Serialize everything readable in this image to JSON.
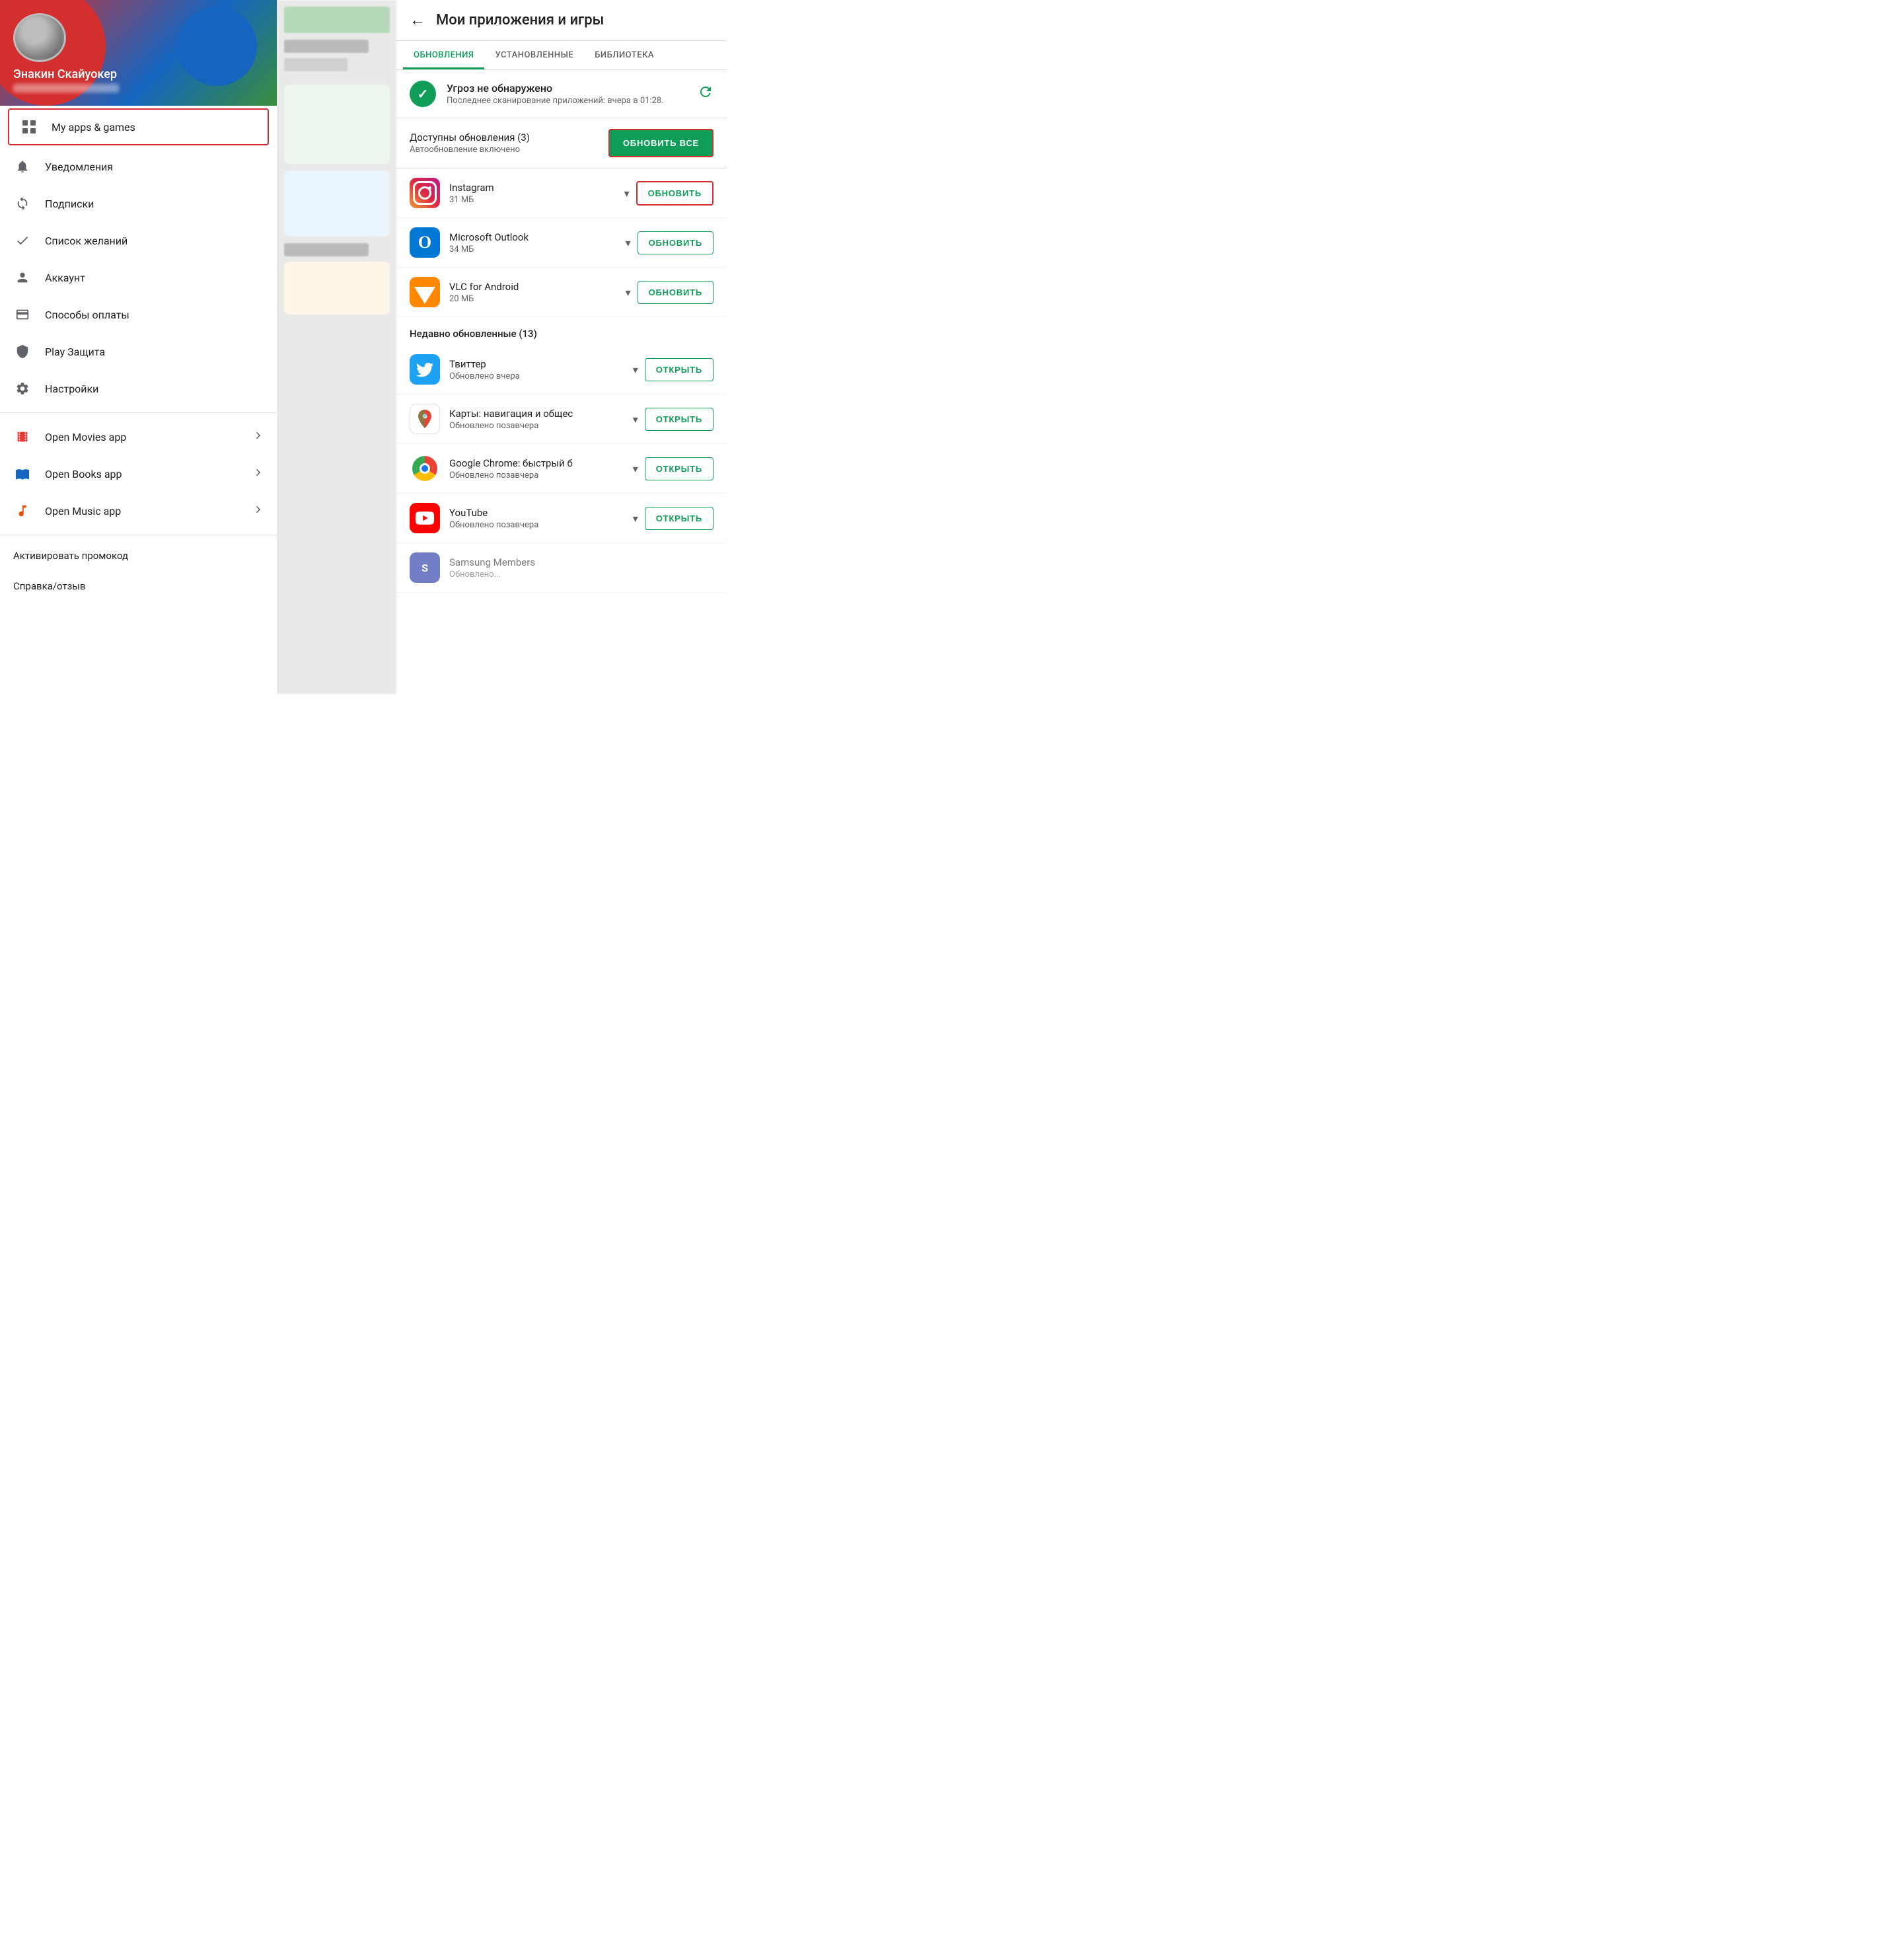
{
  "leftPanel": {
    "profile": {
      "name": "Энакин Скайуокер"
    },
    "myAppsGames": "My apps & games",
    "navItems": [
      {
        "id": "notifications",
        "label": "Уведомления",
        "icon": "bell"
      },
      {
        "id": "subscriptions",
        "label": "Подписки",
        "icon": "refresh"
      },
      {
        "id": "wishlist",
        "label": "Список желаний",
        "icon": "check"
      },
      {
        "id": "account",
        "label": "Аккаунт",
        "icon": "person"
      },
      {
        "id": "payment",
        "label": "Способы оплаты",
        "icon": "card"
      },
      {
        "id": "playprotect",
        "label": "Play Защита",
        "icon": "shield"
      },
      {
        "id": "settings",
        "label": "Настройки",
        "icon": "gear"
      }
    ],
    "appLinks": [
      {
        "id": "movies",
        "label": "Open Movies app",
        "icon": "movies"
      },
      {
        "id": "books",
        "label": "Open Books app",
        "icon": "books"
      },
      {
        "id": "music",
        "label": "Open Music app",
        "icon": "music"
      }
    ],
    "bottomLinks": [
      {
        "id": "promo",
        "label": "Активировать промокод"
      },
      {
        "id": "help",
        "label": "Справка/отзыв"
      }
    ]
  },
  "rightPanel": {
    "header": {
      "backLabel": "←",
      "title": "Мои приложения и игры"
    },
    "tabs": [
      {
        "id": "updates",
        "label": "ОБНОВЛЕНИЯ",
        "active": true
      },
      {
        "id": "installed",
        "label": "УСТАНОВЛЕННЫЕ",
        "active": false
      },
      {
        "id": "library",
        "label": "БИБЛИОТЕКА",
        "active": false
      }
    ],
    "security": {
      "title": "Угроз не обнаружено",
      "subtitle": "Последнее сканирование приложений: вчера в 01:28."
    },
    "updateSection": {
      "title": "Доступны обновления (3)",
      "subtitle": "Автообновление включено",
      "updateAllLabel": "ОБНОВИТЬ ВСЕ"
    },
    "apps": [
      {
        "id": "instagram",
        "name": "Instagram",
        "meta": "31 МБ",
        "iconType": "instagram",
        "actionLabel": "ОБНОВИТЬ",
        "actionType": "update",
        "highlighted": true
      },
      {
        "id": "outlook",
        "name": "Microsoft Outlook",
        "meta": "34 МБ",
        "iconType": "outlook",
        "actionLabel": "ОБНОВИТЬ",
        "actionType": "update",
        "highlighted": false
      },
      {
        "id": "vlc",
        "name": "VLC for Android",
        "meta": "20 МБ",
        "iconType": "vlc",
        "actionLabel": "ОБНОВИТЬ",
        "actionType": "update",
        "highlighted": false
      }
    ],
    "recentSection": {
      "title": "Недавно обновленные (13)"
    },
    "recentApps": [
      {
        "id": "twitter",
        "name": "Твиттер",
        "meta": "Обновлено вчера",
        "iconType": "twitter",
        "actionLabel": "ОТКРЫТЬ",
        "actionType": "open"
      },
      {
        "id": "maps",
        "name": "Карты: навигация и общес",
        "meta": "Обновлено позавчера",
        "iconType": "maps",
        "actionLabel": "ОТКРЫТЬ",
        "actionType": "open"
      },
      {
        "id": "chrome",
        "name": "Google Chrome: быстрый б",
        "meta": "Обновлено позавчера",
        "iconType": "chrome",
        "actionLabel": "ОТКРЫТЬ",
        "actionType": "open"
      },
      {
        "id": "youtube",
        "name": "YouTube",
        "meta": "Обновлено позавчера",
        "iconType": "youtube",
        "actionLabel": "ОТКРЫТЬ",
        "actionType": "open"
      }
    ]
  }
}
